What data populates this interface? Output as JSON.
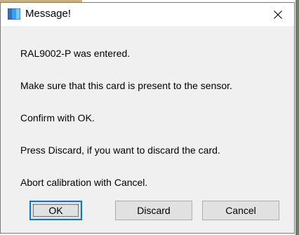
{
  "window": {
    "title": "Message!",
    "icon": "app-icon",
    "close_icon": "close-icon",
    "close_glyph": "✕"
  },
  "message": {
    "lines": [
      "RAL9002-P was entered.",
      "Make sure that this card is present to the sensor.",
      "Confirm with OK.",
      "Press Discard, if you want to discard the card.",
      "Abort calibration with Cancel."
    ]
  },
  "buttons": {
    "ok": "OK",
    "discard": "Discard",
    "cancel": "Cancel"
  },
  "colors": {
    "accent": "#0078d7",
    "dialog_bg": "#f0f0f0",
    "button_bg": "#e1e1e1"
  }
}
